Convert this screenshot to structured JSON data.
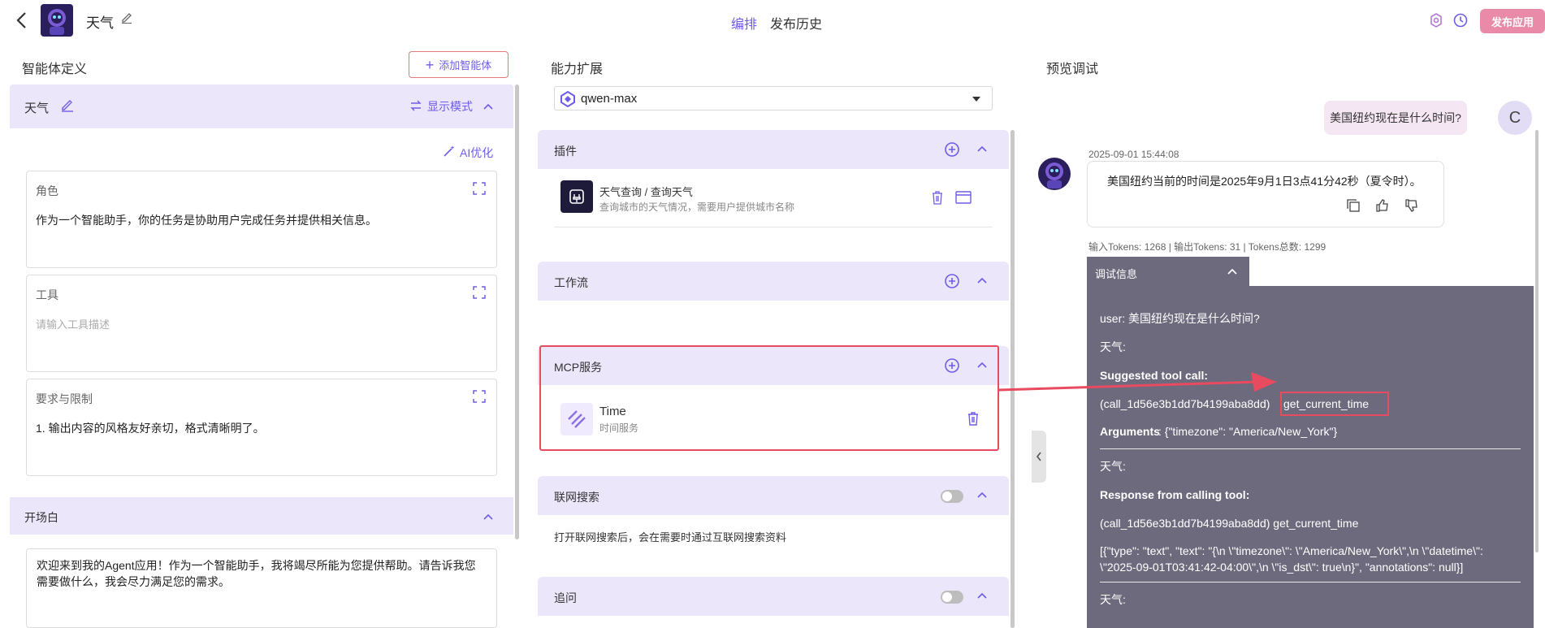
{
  "header": {
    "app_title": "天气",
    "tabs": [
      {
        "label": "编排",
        "active": true
      },
      {
        "label": "发布历史",
        "active": false
      }
    ],
    "publish_button": "发布应用",
    "accent_color": "#6c5ce7",
    "publish_color": "#e88aa8"
  },
  "left": {
    "section_title": "智能体定义",
    "add_agent_button": "添加智能体",
    "agent_name": "天气",
    "display_mode": "显示模式",
    "ai_optimize": "AI优化",
    "fields": [
      {
        "label": "角色",
        "value": "作为一个智能助手，你的任务是协助用户完成任务并提供相关信息。",
        "placeholder": ""
      },
      {
        "label": "工具",
        "value": "",
        "placeholder": "请输入工具描述"
      },
      {
        "label": "要求与限制",
        "value": "1.  输出内容的风格友好亲切，格式清晰明了。",
        "placeholder": ""
      }
    ],
    "opening": {
      "title": "开场白",
      "text": "欢迎来到我的Agent应用！作为一个智能助手，我将竭尽所能为您提供帮助。请告诉我您需要做什么，我会尽力满足您的需求。"
    }
  },
  "middle": {
    "section_title": "能力扩展",
    "model": "qwen-max",
    "plugins": {
      "title": "插件",
      "items": [
        {
          "name": "天气查询 / 查询天气",
          "desc": "查询城市的天气情况，需要用户提供城市名称"
        }
      ]
    },
    "workflow": {
      "title": "工作流"
    },
    "mcp": {
      "title": "MCP服务",
      "items": [
        {
          "name": "Time",
          "desc": "时间服务"
        }
      ]
    },
    "web_search": {
      "title": "联网搜索",
      "desc": "打开联网搜索后，会在需要时通过互联网搜索资料",
      "enabled": false
    },
    "followup": {
      "title": "追问",
      "enabled": false
    }
  },
  "right": {
    "section_title": "预览调试",
    "user_message": "美国纽约现在是什么时间?",
    "user_avatar_letter": "C",
    "bot_time": "2025-09-01 15:44:08",
    "bot_message": "美国纽约当前的时间是2025年9月1日3点41分42秒（夏令时）。",
    "tokens": "输入Tokens: 1268 |  输出Tokens: 31 |  Tokens总数: 1299",
    "debug": {
      "title": "调试信息",
      "user_line": "user: 美国纽约现在是什么时间?",
      "agent1": "天气:",
      "suggested_label": "Suggested tool call:",
      "call_id": "(call_1d56e3b1dd7b4199aba8dd)",
      "call_fn": "get_current_time",
      "arguments_label": "Arguments",
      "arguments_value": ": {\"timezone\": \"America/New_York\"}",
      "agent2": "天气:",
      "response_label": "Response from calling tool:",
      "response_call": "(call_1d56e3b1dd7b4199aba8dd) get_current_time",
      "response_json_1": "[{\"type\": \"text\", \"text\": \"{\\n  \\\"timezone\\\": \\\"America/New_York\\\",\\n  \\\"datetime\\\":",
      "response_json_2": "\\\"2025-09-01T03:41:42-04:00\\\",\\n  \\\"is_dst\\\": true\\n}\", \"annotations\": null}]",
      "agent3": "天气:"
    }
  }
}
